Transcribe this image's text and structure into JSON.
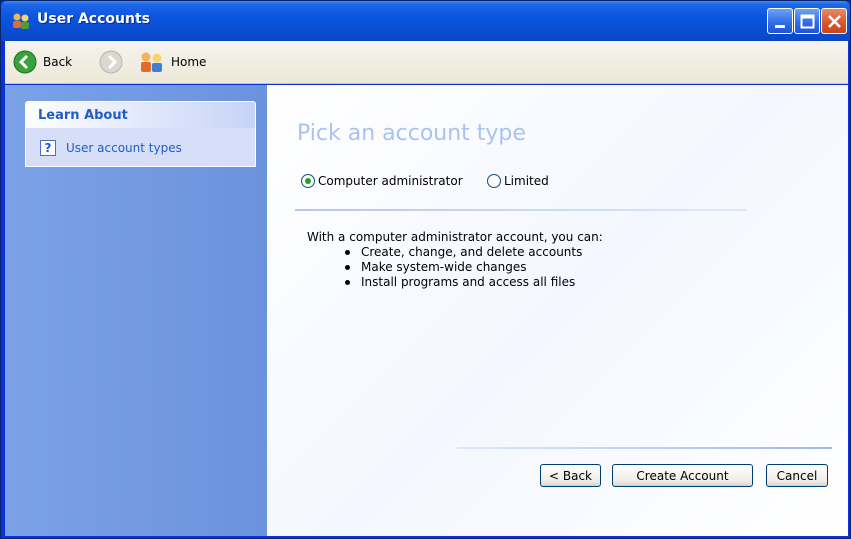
{
  "window": {
    "title": "User Accounts"
  },
  "toolbar": {
    "back_label": "Back",
    "home_label": "Home"
  },
  "sidebar": {
    "section_title": "Learn About",
    "links": [
      {
        "label": "User account types",
        "icon": "help-icon"
      }
    ]
  },
  "main": {
    "heading": "Pick an account type",
    "options": [
      {
        "label": "Computer administrator",
        "selected": true
      },
      {
        "label": "Limited",
        "selected": false
      }
    ],
    "description": "With a computer administrator account, you can:",
    "capabilities": [
      "Create, change, and delete accounts",
      "Make system-wide changes",
      "Install programs and access all files"
    ]
  },
  "buttons": {
    "back": "< Back",
    "create": "Create Account",
    "cancel": "Cancel"
  },
  "colors": {
    "titlebar": "#0a4ed4",
    "sidebar": "#7ba2e7",
    "heading": "#a9c2ef",
    "link": "#215dc6"
  }
}
